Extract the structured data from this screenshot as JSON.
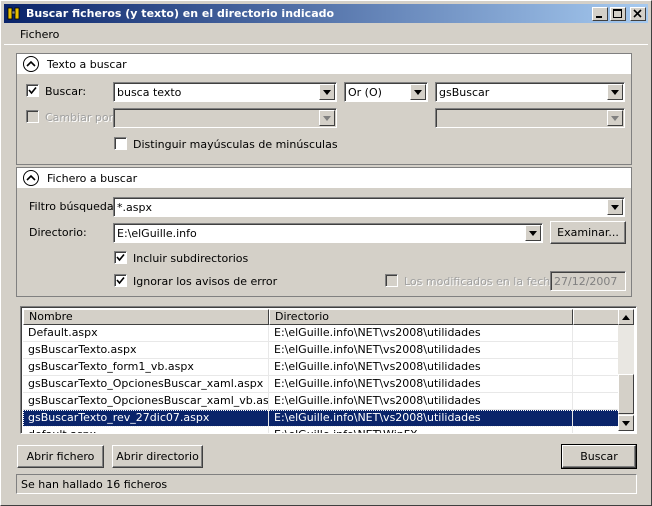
{
  "window": {
    "title": "Buscar ficheros (y texto) en el directorio indicado",
    "controls": [
      "minimize",
      "maximize",
      "close"
    ]
  },
  "menu": {
    "items": [
      "Fichero"
    ]
  },
  "texto_panel": {
    "header": "Texto a buscar",
    "buscar_label": "Buscar:",
    "buscar_checked": true,
    "buscar_value": "busca texto",
    "operator_value": "Or (O)",
    "variable_value": "gsBuscar",
    "cambiar_label": "Cambiar por:",
    "cambiar_checked": false,
    "cambiar_value": "",
    "cambiar_variable_value": "",
    "case_label": "Distinguir mayúsculas de minúsculas",
    "case_checked": false
  },
  "fichero_panel": {
    "header": "Fichero a buscar",
    "filtro_label": "Filtro búsqueda:",
    "filtro_value": "*.aspx",
    "directorio_label": "Directorio:",
    "directorio_value": "E:\\elGuille.info",
    "examinar_label": "Examinar...",
    "subdir_label": "Incluir subdirectorios",
    "subdir_checked": true,
    "ignorar_label": "Ignorar los avisos de error",
    "ignorar_checked": true,
    "modificados_label": "Los modificados en la fecha:",
    "modificados_checked": false,
    "fecha_value": "27/12/2007"
  },
  "results": {
    "columns": [
      "Nombre",
      "Directorio"
    ],
    "rows": [
      {
        "nombre": "Default.aspx",
        "directorio": "E:\\elGuille.info\\NET\\vs2008\\utilidades",
        "selected": false
      },
      {
        "nombre": "gsBuscarTexto.aspx",
        "directorio": "E:\\elGuille.info\\NET\\vs2008\\utilidades",
        "selected": false
      },
      {
        "nombre": "gsBuscarTexto_form1_vb.aspx",
        "directorio": "E:\\elGuille.info\\NET\\vs2008\\utilidades",
        "selected": false
      },
      {
        "nombre": "gsBuscarTexto_OpcionesBuscar_xaml.aspx",
        "directorio": "E:\\elGuille.info\\NET\\vs2008\\utilidades",
        "selected": false
      },
      {
        "nombre": "gsBuscarTexto_OpcionesBuscar_xaml_vb.aspx",
        "directorio": "E:\\elGuille.info\\NET\\vs2008\\utilidades",
        "selected": false
      },
      {
        "nombre": "gsBuscarTexto_rev_27dic07.aspx",
        "directorio": "E:\\elGuille.info\\NET\\vs2008\\utilidades",
        "selected": true
      },
      {
        "nombre": "default.aspx",
        "directorio": "E:\\elGuille.info\\NET\\WinFX",
        "selected": false
      }
    ]
  },
  "buttons": {
    "abrir_fichero": "Abrir fichero",
    "abrir_directorio": "Abrir directorio",
    "buscar": "Buscar"
  },
  "status": {
    "text": "Se han hallado 16 ficheros"
  }
}
